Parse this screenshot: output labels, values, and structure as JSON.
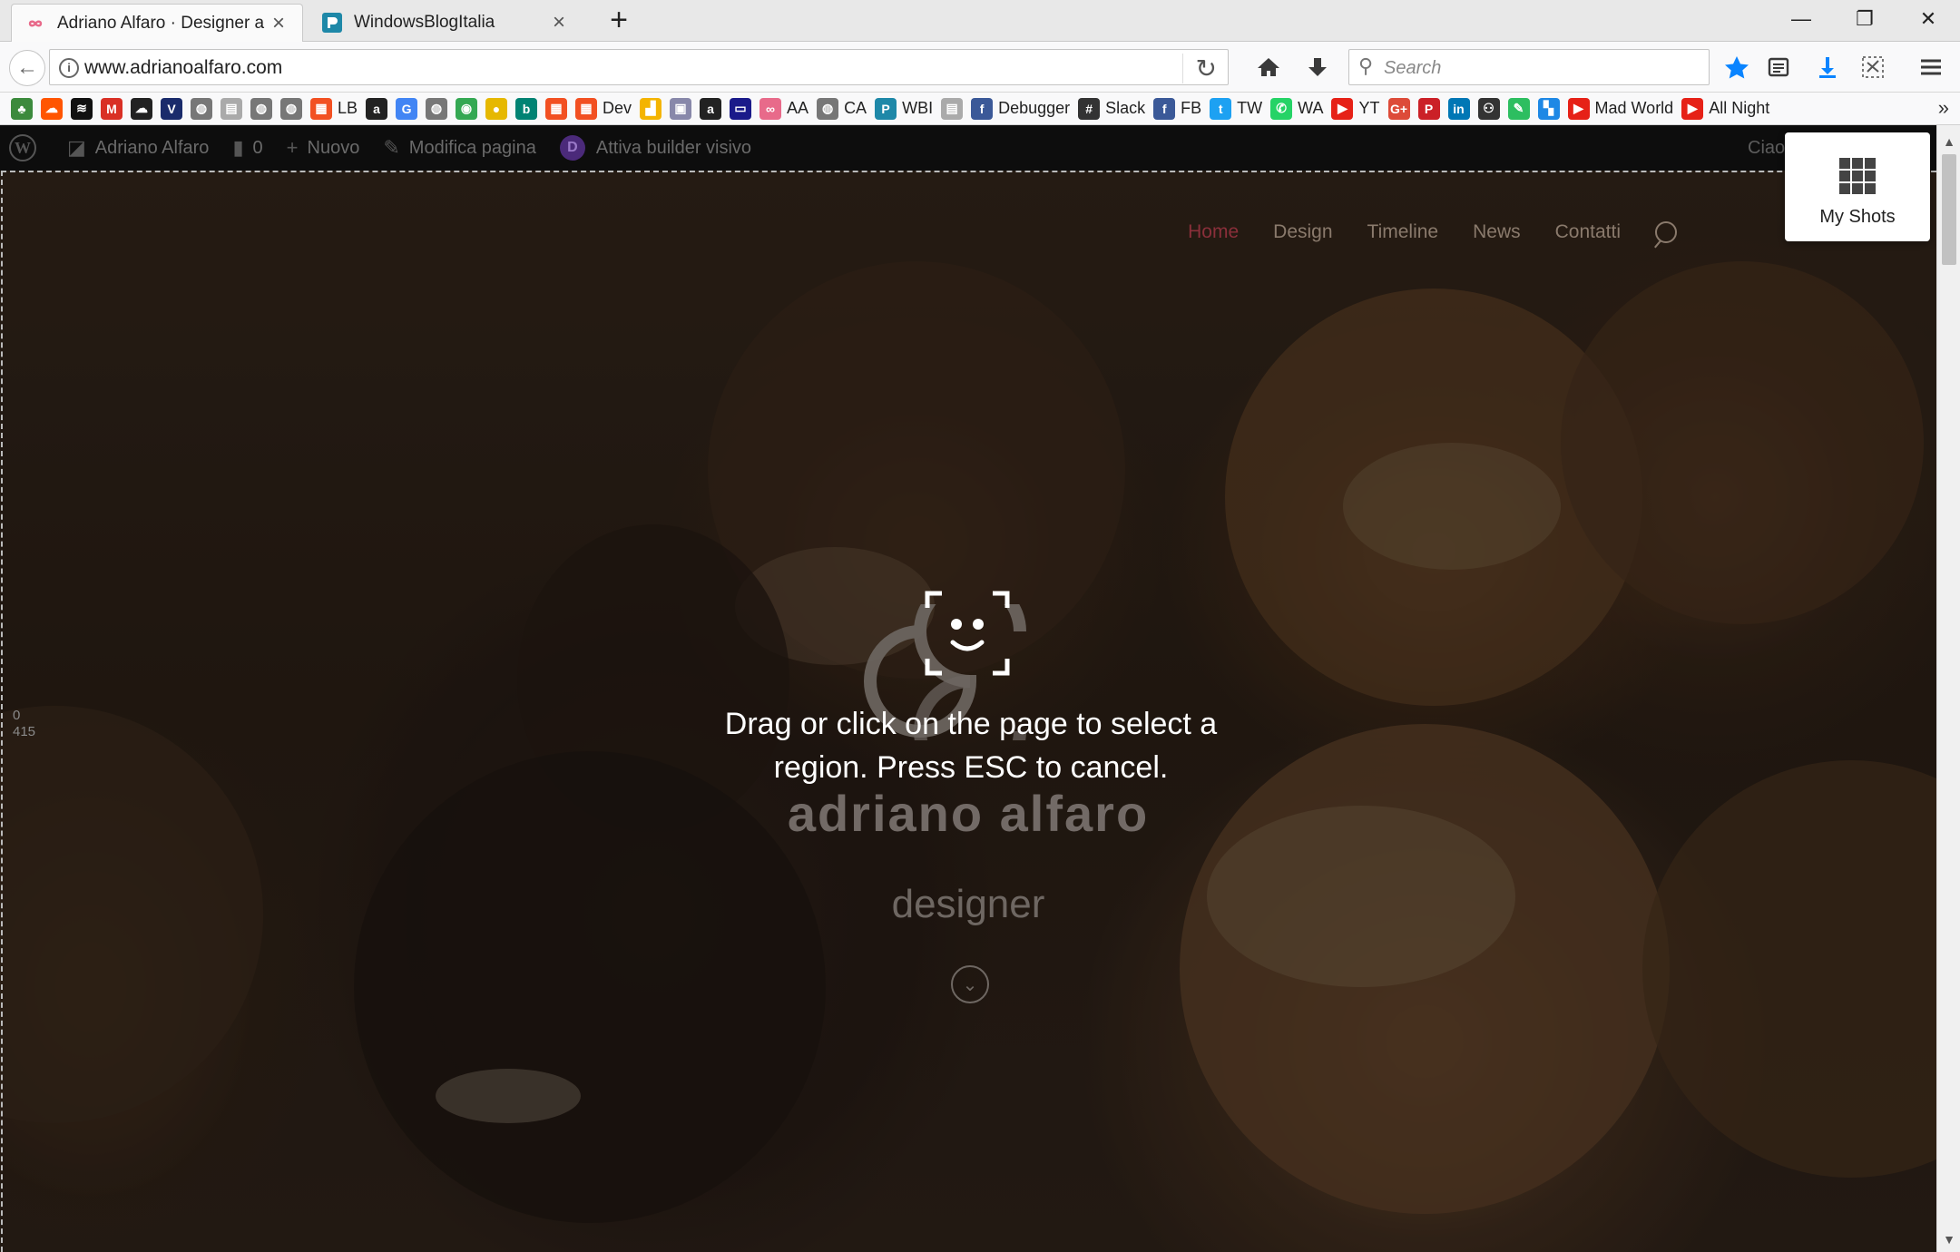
{
  "browser": {
    "tabs": [
      {
        "title": "Adriano Alfaro · Designer a S",
        "active": true
      },
      {
        "title": "WindowsBlogItalia",
        "active": false
      }
    ],
    "url": "www.adrianoalfaro.com",
    "search_placeholder": "Search"
  },
  "bookmarks": [
    {
      "icon": "tree-icon",
      "label": "",
      "color": "#3c8a3c"
    },
    {
      "icon": "soundcloud-icon",
      "label": "",
      "color": "#ff5500"
    },
    {
      "icon": "spotify-icon",
      "label": "",
      "color": "#111111"
    },
    {
      "icon": "gmail-icon",
      "label": "",
      "color": "#d93025"
    },
    {
      "icon": "cloud-icon",
      "label": "",
      "color": "#222222"
    },
    {
      "icon": "vimeo-icon",
      "label": "",
      "color": "#1a2b6b"
    },
    {
      "icon": "globe-icon",
      "label": "",
      "color": "#777777"
    },
    {
      "icon": "page-icon",
      "label": "",
      "color": "#aaaaaa"
    },
    {
      "icon": "globe-icon",
      "label": "",
      "color": "#777777"
    },
    {
      "icon": "globe-icon",
      "label": "",
      "color": "#777777"
    },
    {
      "icon": "windows-icon",
      "label": "LB",
      "color": "#f25022"
    },
    {
      "icon": "amazon-icon",
      "label": "",
      "color": "#222222"
    },
    {
      "icon": "google-icon",
      "label": "",
      "color": "#4285f4"
    },
    {
      "icon": "globe-icon",
      "label": "",
      "color": "#777777"
    },
    {
      "icon": "chrome-icon",
      "label": "",
      "color": "#34a853"
    },
    {
      "icon": "circle-icon",
      "label": "",
      "color": "#e6b800"
    },
    {
      "icon": "bing-icon",
      "label": "",
      "color": "#008373"
    },
    {
      "icon": "windows-icon",
      "label": "",
      "color": "#f25022"
    },
    {
      "icon": "windows-icon",
      "label": "Dev",
      "color": "#f25022"
    },
    {
      "icon": "analytics-icon",
      "label": "",
      "color": "#f4b400"
    },
    {
      "icon": "calendar-icon",
      "label": "",
      "color": "#8888aa"
    },
    {
      "icon": "amazon-icon",
      "label": "",
      "color": "#222222"
    },
    {
      "icon": "bag-icon",
      "label": "",
      "color": "#1a1a8a"
    },
    {
      "icon": "infinity-icon",
      "label": "AA",
      "color": "#e86a8a"
    },
    {
      "icon": "globe-icon",
      "label": "CA",
      "color": "#777777"
    },
    {
      "icon": "blog-icon",
      "label": "WBI",
      "color": "#1e88a8"
    },
    {
      "icon": "page-icon",
      "label": "",
      "color": "#aaaaaa"
    },
    {
      "icon": "facebook-icon",
      "label": "Debugger",
      "color": "#3b5998"
    },
    {
      "icon": "slack-icon",
      "label": "Slack",
      "color": "#333333"
    },
    {
      "icon": "facebook-icon",
      "label": "FB",
      "color": "#3b5998"
    },
    {
      "icon": "twitter-icon",
      "label": "TW",
      "color": "#1da1f2"
    },
    {
      "icon": "whatsapp-icon",
      "label": "WA",
      "color": "#25d366"
    },
    {
      "icon": "youtube-icon",
      "label": "YT",
      "color": "#e62117"
    },
    {
      "icon": "googleplus-icon",
      "label": "",
      "color": "#dd4b39"
    },
    {
      "icon": "pinterest-icon",
      "label": "",
      "color": "#cb2027"
    },
    {
      "icon": "linkedin-icon",
      "label": "",
      "color": "#0077b5"
    },
    {
      "icon": "people-icon",
      "label": "",
      "color": "#333333"
    },
    {
      "icon": "evernote-icon",
      "label": "",
      "color": "#2dbe60"
    },
    {
      "icon": "squares-icon",
      "label": "",
      "color": "#1e88e5"
    },
    {
      "icon": "youtube-icon",
      "label": "Mad World",
      "color": "#e62117"
    },
    {
      "icon": "youtube-icon",
      "label": "All Night",
      "color": "#e62117"
    }
  ],
  "admin_bar": {
    "site": "Adriano Alfaro",
    "comments": "0",
    "new": "Nuovo",
    "edit": "Modifica pagina",
    "builder": "Attiva builder visivo",
    "greeting": "Ciao"
  },
  "site": {
    "nav": [
      "Home",
      "Design",
      "Timeline",
      "News",
      "Contatti"
    ],
    "name": "adriano alfaro",
    "tagline": "designer"
  },
  "overlay": {
    "instruction": "Drag or click on the page to select a region. Press ESC to cancel.",
    "coords_x": "0",
    "coords_y": "415"
  },
  "my_shots": {
    "label": "My Shots"
  },
  "colors": {
    "nav_active": "#8a2f3a",
    "star": "#0a84ff",
    "download": "#0a84ff"
  }
}
